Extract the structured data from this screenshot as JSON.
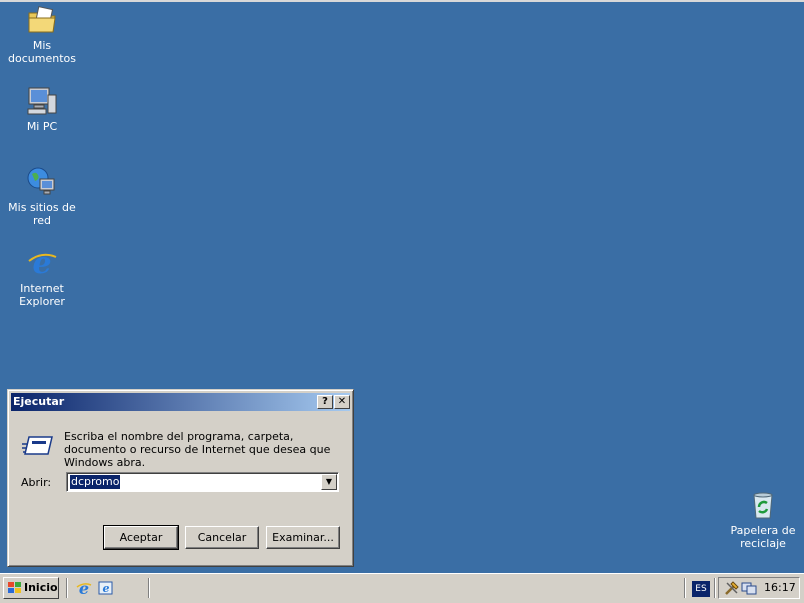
{
  "desktop": {
    "icons": [
      {
        "label": "Mis documentos"
      },
      {
        "label": "Mi PC"
      },
      {
        "label": "Mis sitios de red"
      },
      {
        "label": "Internet Explorer"
      },
      {
        "label": "Papelera de reciclaje"
      }
    ],
    "background_color": "#3a6ea5"
  },
  "dialog": {
    "title": "Ejecutar",
    "help_button": "?",
    "close_button": "✕",
    "description": "Escriba el nombre del programa, carpeta, documento o recurso de Internet que desea que Windows abra.",
    "open_label": "Abrir:",
    "open_value": "dcpromo",
    "ok_button": "Aceptar",
    "cancel_button": "Cancelar",
    "browse_button": "Examinar..."
  },
  "taskbar": {
    "start_label": "Inicio",
    "language": "ES",
    "clock": "16:17"
  }
}
